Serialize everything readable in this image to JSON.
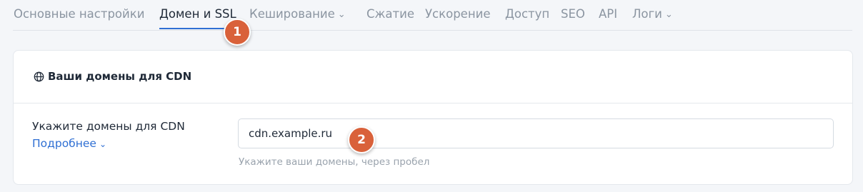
{
  "tabs": [
    {
      "label": "Основные настройки",
      "active": false,
      "dropdown": false
    },
    {
      "label": "Домен и SSL",
      "active": true,
      "dropdown": false
    },
    {
      "label": "Кеширование",
      "active": false,
      "dropdown": true
    },
    {
      "label": "Сжатие",
      "active": false,
      "dropdown": false
    },
    {
      "label": "Ускорение",
      "active": false,
      "dropdown": false
    },
    {
      "label": "Доступ",
      "active": false,
      "dropdown": false
    },
    {
      "label": "SEO",
      "active": false,
      "dropdown": false
    },
    {
      "label": "API",
      "active": false,
      "dropdown": false
    },
    {
      "label": "Логи",
      "active": false,
      "dropdown": true
    }
  ],
  "markers": {
    "step1": "1",
    "step2": "2"
  },
  "card": {
    "title": "Ваши домены для CDN",
    "title_icon": "globe-icon",
    "field_label": "Укажите домены для CDN",
    "more_link": "Подробнее",
    "input_value": "cdn.example.ru",
    "hint": "Укажите ваши домены, через пробел"
  },
  "colors": {
    "accent": "#2f6fd3",
    "marker": "#d9613a",
    "inactive_tab": "#8b95a1",
    "text": "#1f2937",
    "hint": "#9aa3ad"
  }
}
